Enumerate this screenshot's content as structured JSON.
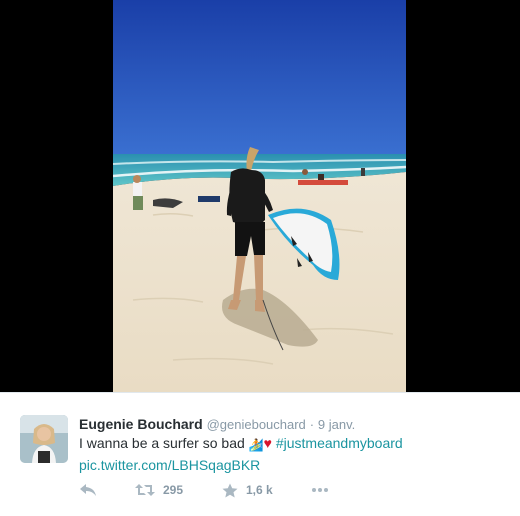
{
  "tweet": {
    "author_name": "Eugenie Bouchard",
    "handle": "@geniebouchard",
    "separator": "·",
    "time": "9 janv.",
    "text": "I wanna be a surfer so bad",
    "emoji_surfer": "🏄",
    "emoji_heart": "♥",
    "hashtag": "#justmeandmyboard",
    "link": "pic.twitter.com/LBHSqagBKR"
  },
  "actions": {
    "reply_icon": "reply-icon",
    "retweet_icon": "retweet-icon",
    "retweet_count": "295",
    "favorite_icon": "star-icon",
    "favorite_count": "1,6 k",
    "more_icon": "more-icon"
  },
  "colors": {
    "link": "#1b95a0",
    "heart": "#d8142b",
    "muted": "#8899a6",
    "text": "#292f33",
    "media_background": "#000000"
  }
}
